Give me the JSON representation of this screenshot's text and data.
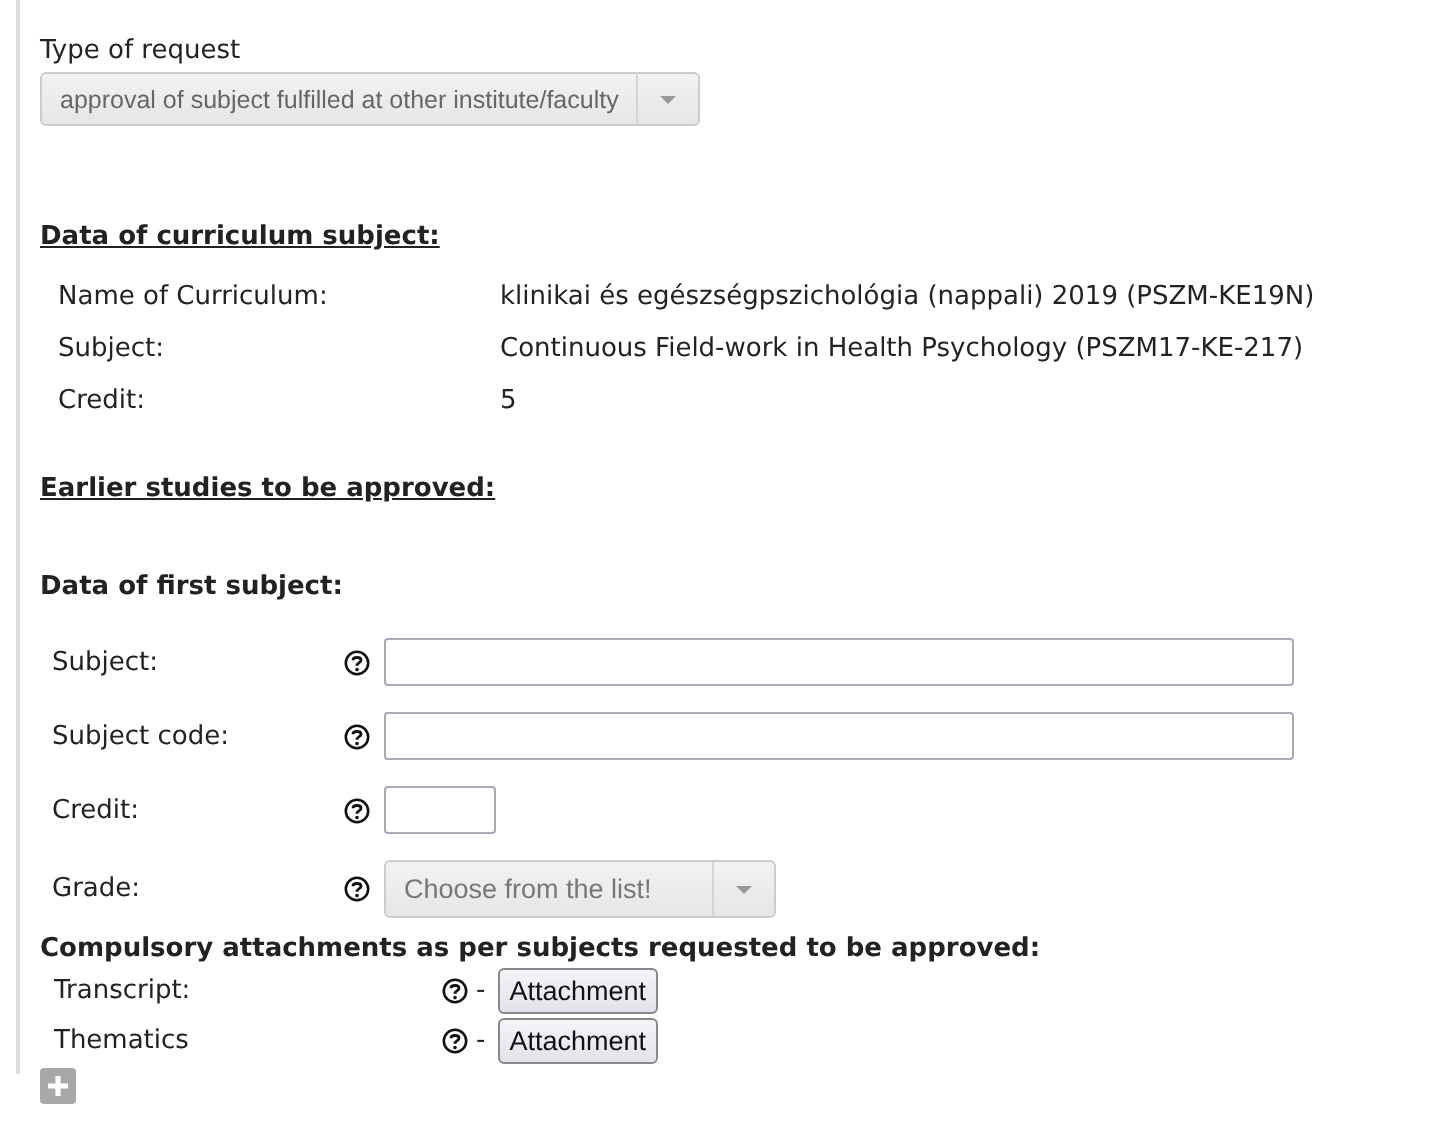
{
  "request_type": {
    "label": "Type of request",
    "value": "approval of subject fulfilled at other institute/faculty"
  },
  "curriculum": {
    "heading": "Data of curriculum subject:",
    "rows": [
      {
        "label": "Name of Curriculum:",
        "value": "klinikai és egészségpszichológia (nappali) 2019 (PSZM-KE19N)"
      },
      {
        "label": "Subject:",
        "value": "Continuous Field-work in Health Psychology (PSZM17-KE-217)"
      },
      {
        "label": "Credit:",
        "value": "5"
      }
    ]
  },
  "earlier_heading": "Earlier studies to be approved:",
  "first_subject": {
    "heading": "Data of first subject:",
    "fields": [
      {
        "kind": "text",
        "label": "Subject:"
      },
      {
        "kind": "text",
        "label": "Subject code:"
      },
      {
        "kind": "short",
        "label": "Credit:"
      },
      {
        "kind": "select",
        "label": "Grade:",
        "placeholder": "Choose from the list!"
      }
    ]
  },
  "attachments": {
    "heading": "Compulsory attachments as per subjects requested to be approved:",
    "items": [
      {
        "label": "Transcript:",
        "separator": "-",
        "button": "Attachment"
      },
      {
        "label": "Thematics",
        "separator": "-",
        "button": "Attachment"
      }
    ]
  }
}
